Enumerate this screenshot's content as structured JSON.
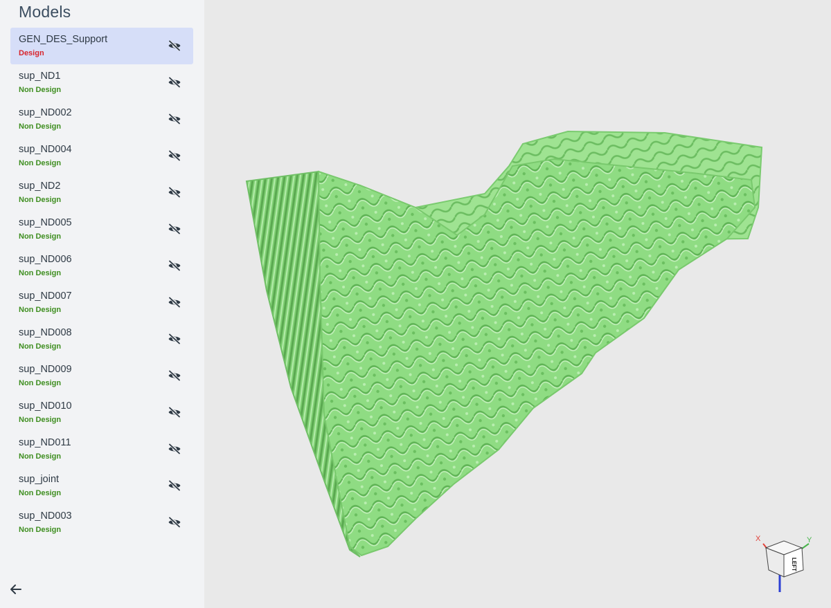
{
  "panel": {
    "title": "Models"
  },
  "models": [
    {
      "name": "GEN_DES_Support",
      "type": "Design",
      "selected": true
    },
    {
      "name": "sup_ND1",
      "type": "Non Design"
    },
    {
      "name": "sup_ND002",
      "type": "Non Design"
    },
    {
      "name": "sup_ND004",
      "type": "Non Design"
    },
    {
      "name": "sup_ND2",
      "type": "Non Design"
    },
    {
      "name": "sup_ND005",
      "type": "Non Design"
    },
    {
      "name": "sup_ND006",
      "type": "Non Design"
    },
    {
      "name": "sup_ND007",
      "type": "Non Design"
    },
    {
      "name": "sup_ND008",
      "type": "Non Design"
    },
    {
      "name": "sup_ND009",
      "type": "Non Design"
    },
    {
      "name": "sup_ND010",
      "type": "Non Design"
    },
    {
      "name": "sup_ND011",
      "type": "Non Design"
    },
    {
      "name": "sup_joint",
      "type": "Non Design"
    },
    {
      "name": "sup_ND003",
      "type": "Non Design"
    }
  ],
  "icons": {
    "visibility": "eye-off-icon",
    "back": "arrow-left-icon"
  },
  "colors": {
    "design": "#d8252c",
    "non_design": "#3e8e1f",
    "selected_row": "#d6def8",
    "model_fill": "#8fdc83",
    "axis_x": "#e0413a",
    "axis_y": "#47b34a",
    "axis_z": "#2b3fd4"
  },
  "view_cube": {
    "face_label": "LEFT",
    "axes": [
      "X",
      "Y",
      "Z"
    ]
  }
}
